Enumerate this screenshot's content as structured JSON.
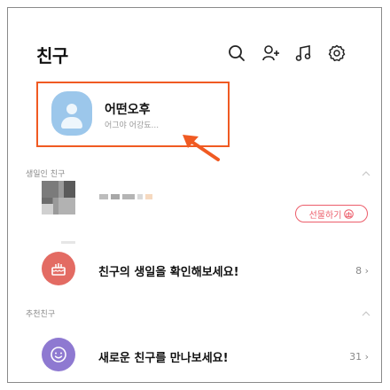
{
  "header": {
    "title": "친구",
    "icons": [
      "search-icon",
      "add-friend-icon",
      "music-icon",
      "settings-icon"
    ]
  },
  "profile": {
    "name": "어떤오후",
    "status": "어그야 어강됴..."
  },
  "birthday_section": {
    "label": "생일인 친구",
    "gift_label": "선물하기",
    "prompt": "친구의 생일을 확인해보세요!",
    "count": "8"
  },
  "recommend_section": {
    "label": "추천친구",
    "prompt": "새로운 친구를 만나보세요!",
    "count": "31"
  },
  "colors": {
    "highlight": "#f05a22",
    "avatar": "#9cc7eb",
    "cake": "#e36b63",
    "smile": "#8e79d1",
    "gift": "#ec5d6a"
  }
}
